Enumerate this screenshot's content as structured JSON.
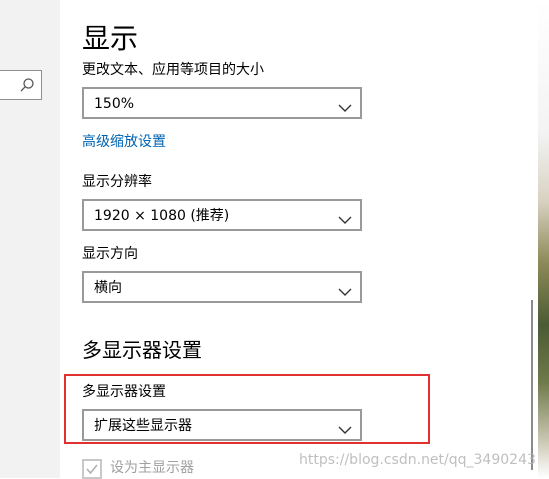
{
  "page": {
    "title": "显示"
  },
  "scale": {
    "label": "更改文本、应用等项目的大小",
    "value": "150%"
  },
  "advanced_scaling_link": "高级缩放设置",
  "resolution": {
    "label": "显示分辨率",
    "value": "1920 × 1080 (推荐)"
  },
  "orientation": {
    "label": "显示方向",
    "value": "横向"
  },
  "multi_display": {
    "section_title": "多显示器设置",
    "label": "多显示器设置",
    "value": "扩展这些显示器"
  },
  "main_display": {
    "label": "设为主显示器",
    "checked": true
  },
  "watermark": "https://blog.csdn.net/qq_3490243",
  "icons": {
    "search": "search-icon",
    "dropdown": "chevron-down-icon",
    "check": "check-icon"
  },
  "colors": {
    "link": "#0063b1",
    "highlight": "#e03030"
  }
}
